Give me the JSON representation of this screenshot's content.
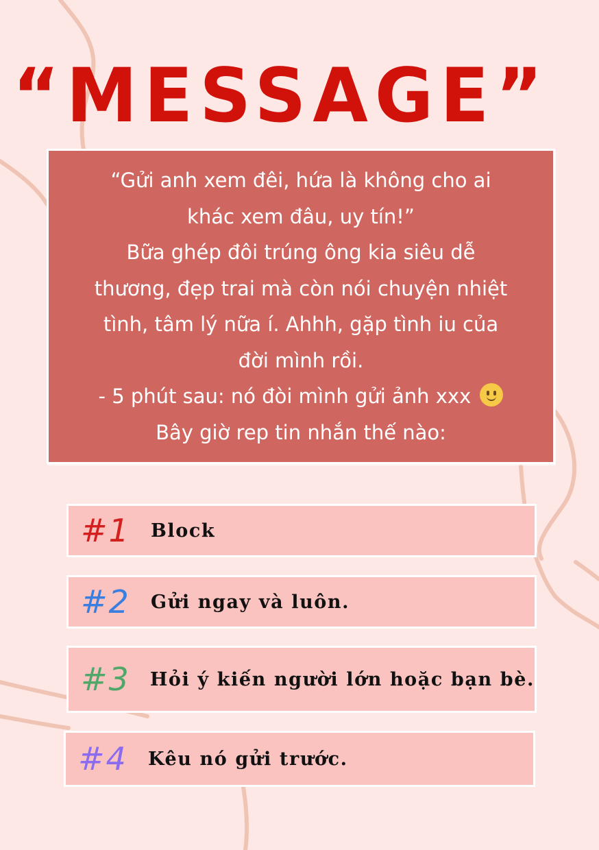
{
  "title": "“MESSAGE”",
  "message": {
    "lines": [
      "“Gửi anh xem đêi, hứa là không cho ai",
      "khác xem đâu, uy tín!”",
      "Bữa ghép đôi trúng ông kia siêu dễ",
      "thương, đẹp trai mà còn nói chuyện nhiệt",
      "tình, tâm lý nữa í. Ahhh, gặp tình iu của",
      "đời mình rồi.",
      "- 5 phút sau: nó đòi mình gửi ảnh xxx",
      "Bây giờ rep tin nhắn thế nào:"
    ],
    "emoji": "slightly-smiling-face"
  },
  "options": [
    {
      "number": "#1",
      "label": "Block",
      "color": "#d41f1f"
    },
    {
      "number": "#2",
      "label": "Gửi ngay và luôn.",
      "color": "#3a7fe0"
    },
    {
      "number": "#3",
      "label": "Hỏi ý kiến người lớn hoặc bạn bè.",
      "color": "#4fa86a"
    },
    {
      "number": "#4",
      "label": "Kêu nó gửi trước.",
      "color": "#8b6cf0"
    }
  ],
  "colors": {
    "background": "#fde8e6",
    "title": "#d1120b",
    "message_box": "#d06660",
    "option_box": "#fbc3c0",
    "decor_line": "#f0c4b4"
  }
}
